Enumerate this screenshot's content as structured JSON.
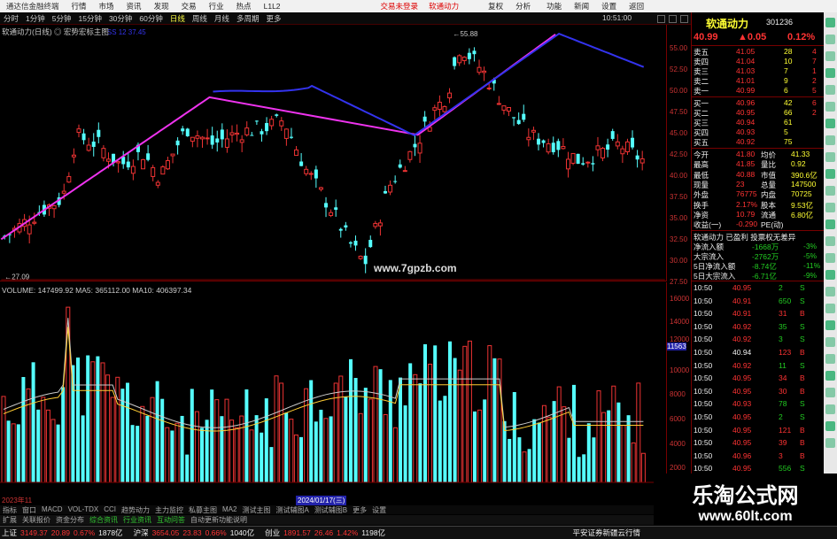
{
  "menubar": {
    "items": [
      "行情",
      "市场",
      "资讯",
      "发现",
      "交易",
      "行业",
      "热点",
      "L1L2"
    ],
    "center_red": [
      "交易未登录",
      "软通动力"
    ],
    "right": [
      "复权",
      "分析",
      "功能",
      "新闻",
      "设置",
      "返回"
    ]
  },
  "app_title": "通达信金融终端",
  "toolbar": {
    "periods": [
      "分时",
      "1分钟",
      "5分钟",
      "15分钟",
      "30分钟",
      "60分钟",
      "日线",
      "周线",
      "月线",
      "多周期",
      "更多"
    ],
    "active": "日线",
    "time": "10:51:00"
  },
  "main": {
    "subtitle": "软通动力(日线) ◎ 宏势宏标主图",
    "line_label": "SS 12 37.45",
    "high_label": "55.88",
    "low_label": "27.09",
    "site": "www.7gpzb.com",
    "yticks": [
      "55.00",
      "52.50",
      "50.00",
      "47.50",
      "45.00",
      "42.50",
      "40.00",
      "37.50",
      "35.00",
      "32.50",
      "30.00",
      "27.50"
    ]
  },
  "volume": {
    "title": "VOLUME: 147499.92  MA5: 365112.00  MA10: 406397.34",
    "yticks": [
      "16000",
      "14000",
      "12000",
      "11563",
      "10000",
      "8000",
      "6000",
      "4000",
      "2000"
    ],
    "date_left": "2023年11",
    "date_mid": "2024/01/17(三)",
    "colors": {
      "up": "#e43",
      "down": "#3ee",
      "ma5": "#ccc",
      "ma10": "#fc3"
    }
  },
  "tabs": [
    "指标",
    "窗口",
    "MACD",
    "VOL-TDX",
    "CCI",
    "趋势动力",
    "主力监控",
    "私募主图",
    "MA2",
    "测试主图",
    "测试辅图A",
    "测试辅图B",
    "更多",
    "设置"
  ],
  "tabs2": [
    "扩展",
    "关联报价",
    "资金分布",
    "综合资讯",
    "行业资讯",
    "互动问答",
    "自动更新功能说明"
  ],
  "stock": {
    "name": "软通动力",
    "code": "301236",
    "price": "40.99",
    "change": "▲0.05",
    "pct": "0.12%"
  },
  "asks": [
    [
      "卖五",
      "41.05",
      "28",
      "4"
    ],
    [
      "卖四",
      "41.04",
      "10",
      "7"
    ],
    [
      "卖三",
      "41.03",
      "7",
      "1"
    ],
    [
      "卖二",
      "41.01",
      "9",
      "2"
    ],
    [
      "卖一",
      "40.99",
      "6",
      "5"
    ]
  ],
  "bids": [
    [
      "买一",
      "40.96",
      "42",
      "6"
    ],
    [
      "买二",
      "40.95",
      "66",
      "2"
    ],
    [
      "买三",
      "40.94",
      "61",
      ""
    ],
    [
      "买四",
      "40.93",
      "5",
      ""
    ],
    [
      "买五",
      "40.92",
      "75",
      ""
    ]
  ],
  "quote": [
    [
      "今开",
      "41.80",
      "均价",
      "41.33"
    ],
    [
      "最高",
      "41.85",
      "量比",
      "0.92"
    ],
    [
      "最低",
      "40.88",
      "市值",
      "390.6亿"
    ],
    [
      "现量",
      "23",
      "总量",
      "147500"
    ],
    [
      "外盘",
      "76775",
      "内盘",
      "70725"
    ],
    [
      "换手",
      "2.17%",
      "股本",
      "9.53亿"
    ],
    [
      "净资",
      "10.79",
      "流通",
      "6.80亿"
    ],
    [
      "收益(一)",
      "-0.290",
      "PE(动)",
      ""
    ]
  ],
  "funds": {
    "header": "软通动力 已盈利 投票权无差异",
    "rows": [
      [
        "净流入额",
        "-1668万",
        "-3%"
      ],
      [
        "大宗流入",
        "-2762万",
        "-5%"
      ],
      [
        "5日净流入额",
        "-8.74亿",
        "-11%"
      ],
      [
        "5日大宗流入",
        "-6.71亿",
        "-9%"
      ]
    ]
  },
  "ticks": [
    [
      "10:50",
      "40.95",
      "2",
      "S"
    ],
    [
      "10:50",
      "40.91",
      "650",
      "S"
    ],
    [
      "10:50",
      "40.91",
      "31",
      "B"
    ],
    [
      "10:50",
      "40.92",
      "35",
      "S"
    ],
    [
      "10:50",
      "40.92",
      "3",
      "S"
    ],
    [
      "10:50",
      "40.94",
      "123",
      "B"
    ],
    [
      "10:50",
      "40.92",
      "11",
      "S"
    ],
    [
      "10:50",
      "40.95",
      "34",
      "B"
    ],
    [
      "10:50",
      "40.95",
      "30",
      "B"
    ],
    [
      "10:50",
      "40.93",
      "78",
      "S"
    ],
    [
      "10:50",
      "40.95",
      "2",
      "S"
    ],
    [
      "10:50",
      "40.95",
      "121",
      "B"
    ],
    [
      "10:50",
      "40.95",
      "39",
      "B"
    ],
    [
      "10:50",
      "40.96",
      "3",
      "B"
    ],
    [
      "10:50",
      "40.95",
      "556",
      "S"
    ]
  ],
  "status": {
    "idx": [
      [
        "上证",
        "3149.37",
        "20.89",
        "0.67%",
        "1878亿"
      ],
      [
        "沪深",
        "3654.05",
        "23.83",
        "0.66%",
        "1040亿"
      ],
      [
        "创业",
        "1891.57",
        "26.46",
        "1.42%",
        "1198亿"
      ]
    ],
    "broker": "平安证券新疆云行情"
  },
  "watermark": {
    "line1": "乐淘公式网",
    "line2": "www.60lt.com"
  }
}
